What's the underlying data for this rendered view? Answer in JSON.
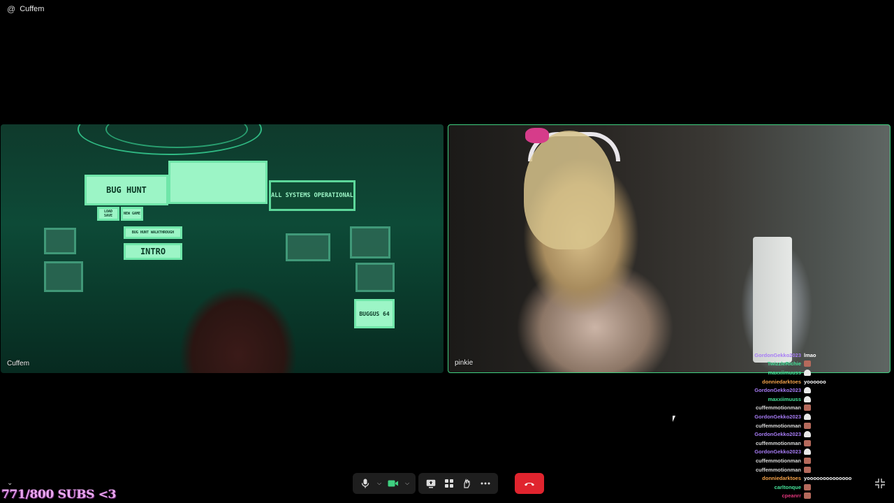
{
  "window": {
    "at_symbol": "@",
    "title": "Cuffem"
  },
  "participants": {
    "left": {
      "name": "Cuffem",
      "screens": {
        "bug_hunt": "BUG HUNT",
        "systems": "ALL SYSTEMS OPERATIONAL",
        "intro": "INTRO",
        "load_save": "LOAD SAVE",
        "new_game": "NEW GAME",
        "walkthrough": "BUG HUNT WALKTHROUGH",
        "buggus": "BUGGUS 64"
      }
    },
    "right": {
      "name": "pinkie"
    }
  },
  "chat": [
    {
      "user": "GordonGekko2023",
      "color": "#a77cf5",
      "message": "lmao",
      "emote": ""
    },
    {
      "user": "TwizzleRichie",
      "color": "#46e39a",
      "message": "",
      "emote": "face"
    },
    {
      "user": "maxxiimuuss",
      "color": "#46e39a",
      "message": "",
      "emote": "ghost"
    },
    {
      "user": "donniedarktoes",
      "color": "#f3a24a",
      "message": "yoooooo",
      "emote": ""
    },
    {
      "user": "GordonGekko2023",
      "color": "#a77cf5",
      "message": "",
      "emote": "ghost"
    },
    {
      "user": "maxxiimuuss",
      "color": "#46e39a",
      "message": "",
      "emote": "ghost"
    },
    {
      "user": "cuffemmotionman",
      "color": "#d9d9d9",
      "message": "",
      "emote": "face"
    },
    {
      "user": "GordonGekko2023",
      "color": "#a77cf5",
      "message": "",
      "emote": "ghost"
    },
    {
      "user": "cuffemmotionman",
      "color": "#d9d9d9",
      "message": "",
      "emote": "face"
    },
    {
      "user": "GordonGekko2023",
      "color": "#a77cf5",
      "message": "",
      "emote": "ghost"
    },
    {
      "user": "cuffemmotionman",
      "color": "#d9d9d9",
      "message": "",
      "emote": "face"
    },
    {
      "user": "GordonGekko2023",
      "color": "#a77cf5",
      "message": "",
      "emote": "ghost"
    },
    {
      "user": "cuffemmotionman",
      "color": "#d9d9d9",
      "message": "",
      "emote": "face"
    },
    {
      "user": "cuffemmotionman",
      "color": "#d9d9d9",
      "message": "",
      "emote": "face"
    },
    {
      "user": "donniedarktoes",
      "color": "#f3a24a",
      "message": "yoooooooooooooo",
      "emote": ""
    },
    {
      "user": "carltonque",
      "color": "#46e39a",
      "message": "",
      "emote": "face"
    },
    {
      "user": "cpeanrr",
      "color": "#e0357a",
      "message": "",
      "emote": "face"
    }
  ],
  "toolbar": {
    "icons": [
      "microphone-icon",
      "chevron-down-icon",
      "camera-icon",
      "chevron-down-icon",
      "share-screen-icon",
      "apps-icon",
      "reactions-icon",
      "more-icon",
      "hang-up-icon"
    ],
    "camera_color": "#3fd080",
    "hangup_color": "#e0242e"
  },
  "overlay": {
    "subs_text": "771/800 SUBS <3"
  }
}
